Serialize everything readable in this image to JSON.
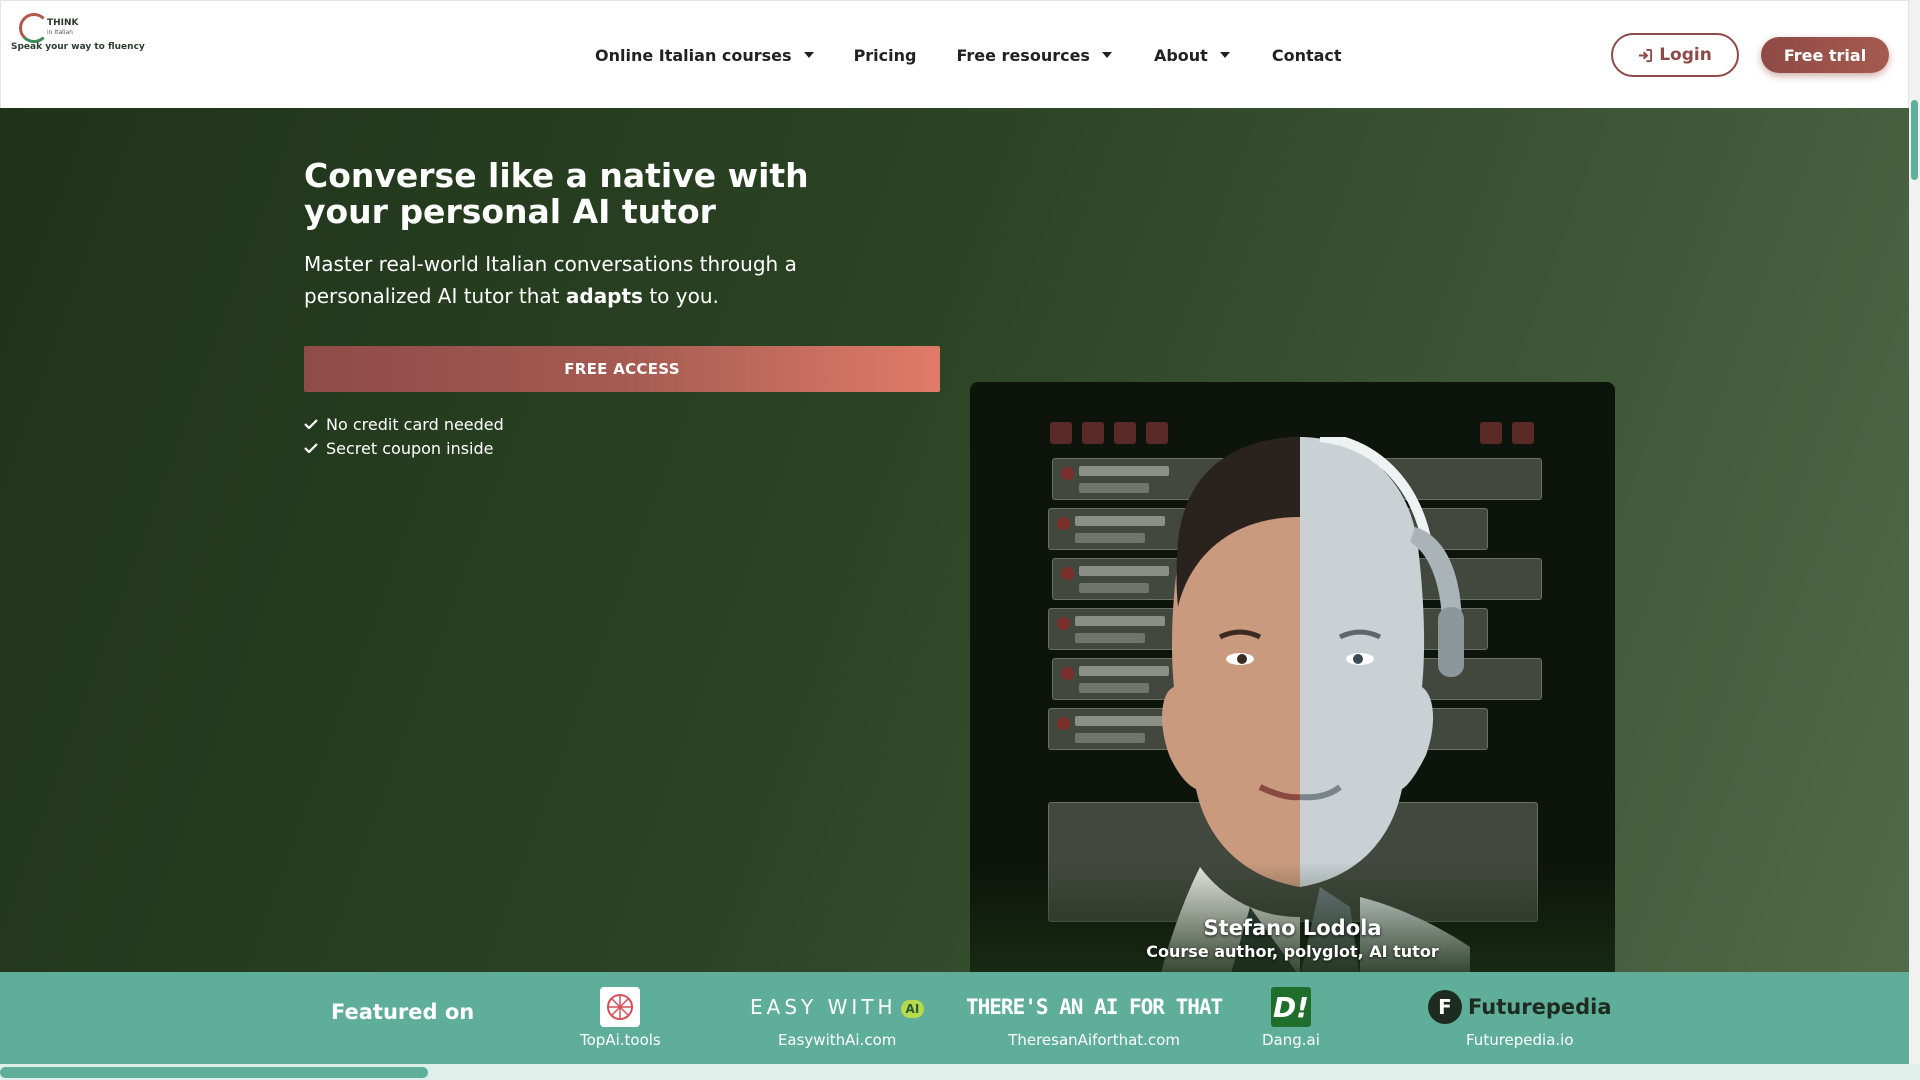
{
  "header": {
    "logo_name": "THINK",
    "logo_sub": "in Italian",
    "logo_tagline": "Speak your way to fluency",
    "nav": [
      {
        "label": "Online Italian courses",
        "has_dropdown": true
      },
      {
        "label": "Pricing",
        "has_dropdown": false
      },
      {
        "label": "Free resources",
        "has_dropdown": true
      },
      {
        "label": "About",
        "has_dropdown": true
      },
      {
        "label": "Contact",
        "has_dropdown": false
      }
    ],
    "login_label": "Login",
    "trial_label": "Free trial"
  },
  "hero": {
    "title": "Converse like a native with your personal AI tutor",
    "subtitle_pre": "Master real-world Italian conversations through a personalized AI tutor that ",
    "subtitle_bold": "adapts",
    "subtitle_post": " to you.",
    "cta_label": "FREE ACCESS",
    "checks": [
      "No credit card needed",
      "Secret coupon inside"
    ]
  },
  "card": {
    "name": "Stefano Lodola",
    "role": "Course author, polyglot, AI tutor"
  },
  "featured": {
    "title": "Featured on",
    "items": [
      {
        "name": "TopAi.tools",
        "icon": "topai-logo"
      },
      {
        "name": "EasywithAi.com",
        "logo_text": "EASY WITH",
        "badge": "AI",
        "icon": "easywithai-logo"
      },
      {
        "name": "TheresanAiforthat.com",
        "logo_text": "THERE'S AN AI FOR THAT",
        "icon": "taaft-logo"
      },
      {
        "name": "Dang.ai",
        "logo_text": "D!",
        "icon": "dang-logo"
      },
      {
        "name": "Futurepedia.io",
        "logo_text": "Futurepedia",
        "icon": "futurepedia-logo"
      }
    ]
  },
  "colors": {
    "brand": "#8e4a47",
    "hero_bg": "#2b4424",
    "featured_bg": "#5fae99",
    "cta_end": "#e07b68"
  }
}
